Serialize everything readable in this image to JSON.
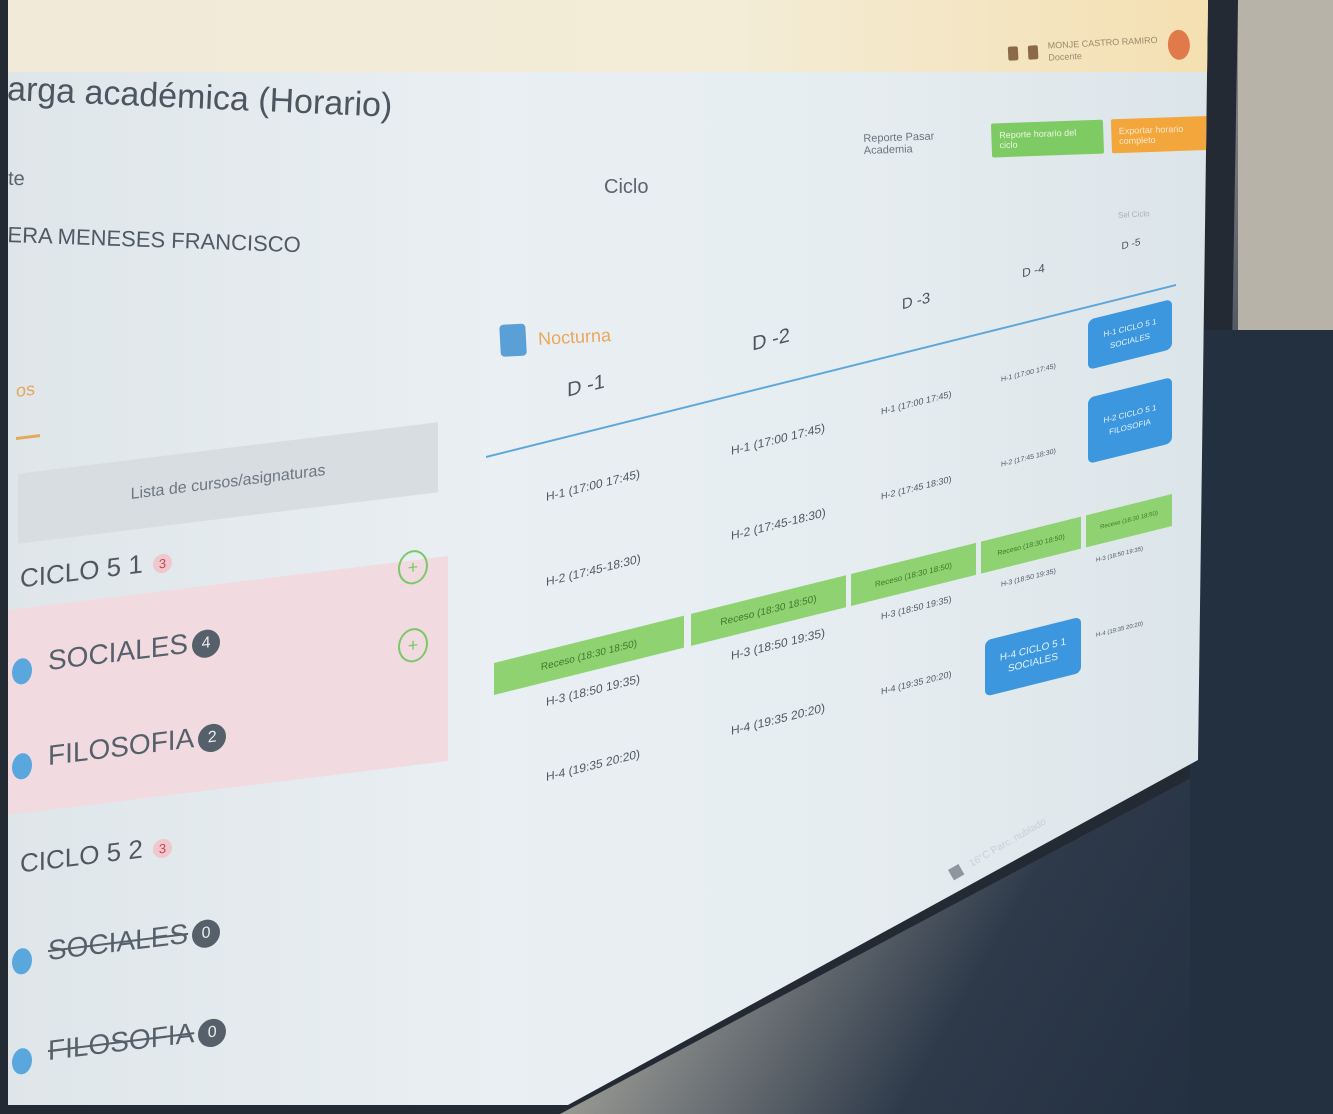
{
  "page": {
    "title": "arga académica (Horario)"
  },
  "labels": {
    "docente": "te",
    "ciclo": "Ciclo"
  },
  "teacher": {
    "name": "ERA MENESES FRANCISCO"
  },
  "actions": {
    "report_link": "Reporte Pasar Academia",
    "green_button": "Reporte horario del ciclo",
    "orange_button": "Exportar horario completo"
  },
  "user": {
    "name": "MONJE CASTRO RAMIRO",
    "role": "Docente"
  },
  "ciclo_select": {
    "placeholder": "Sel Ciclo"
  },
  "left": {
    "partial_label": "os",
    "list_header": "Lista de cursos/asignaturas",
    "groups": [
      {
        "name": "CICLO 5 1",
        "count": "3",
        "courses": [
          {
            "name": "SOCIALES",
            "count": "4"
          },
          {
            "name": "FILOSOFIA",
            "count": "2"
          }
        ]
      },
      {
        "name": "CICLO 5 2",
        "count": "3",
        "courses": [
          {
            "name": "SOCIALES",
            "count": "0"
          },
          {
            "name": "FILOSOFIA",
            "count": "0"
          }
        ]
      }
    ]
  },
  "schedule": {
    "shift": "Nocturna",
    "days": [
      "D -1",
      "D -2",
      "D -3",
      "D -4",
      "D -5"
    ],
    "d1": {
      "h1": "H-1 (17:00 17:45)",
      "h2": "H-2 (17:45-18:30)",
      "recess": "Receso (18:30 18:50)",
      "h3": "H-3 (18:50 19:35)",
      "h4": "H-4 (19:35 20:20)"
    },
    "d2": {
      "h1": "H-1 (17:00 17:45)",
      "h2": "H-2 (17:45-18:30)",
      "recess": "Receso (18:30 18:50)",
      "h3": "H-3 (18:50 19:35)",
      "h4": "H-4 (19:35 20:20)"
    },
    "d3": {
      "h1": "H-1 (17:00 17:45)",
      "h2": "H-2 (17:45 18:30)",
      "recess": "Receso (18:30 18:50)",
      "h3": "H-3 (18:50 19:35)",
      "h4": "H-4 (19:35 20:20)"
    },
    "d4": {
      "h1": "H-1 (17:00 17:45)",
      "h2": "H-2 (17:45 18:30)",
      "recess": "Receso (18:30 18:50)",
      "h3": "H-3 (18:50 19:35)",
      "block_title": "H-4 CICLO 5 1",
      "block_sub": "SOCIALES"
    },
    "d5": {
      "block1_title": "H-1 CICLO 5 1",
      "block1_sub": "SOCIALES",
      "block2_title": "H-2 CICLO 5 1",
      "block2_sub": "FILOSOFIA",
      "recess": "Receso (18:30 18:50)",
      "h3": "H-3 (18:50 19:35)",
      "h4": "H-4 (19:35 20:20)"
    }
  },
  "taskbar": {
    "weather": "16°C Parc. nublado"
  }
}
